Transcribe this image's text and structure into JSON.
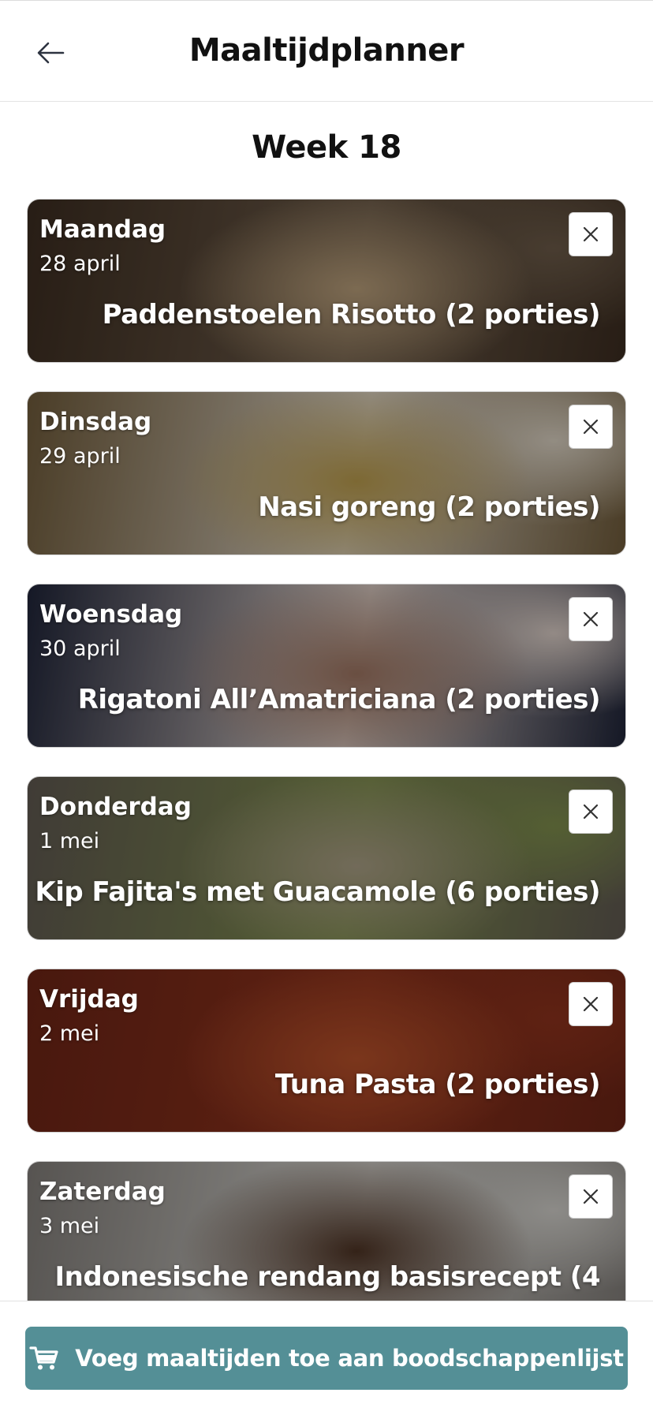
{
  "header": {
    "title": "Maaltijdplanner",
    "back_icon": "arrow-left-icon"
  },
  "week": {
    "label": "Week 18"
  },
  "days": [
    {
      "day": "Maandag",
      "date": "28 april",
      "meal": "Paddenstoelen Risotto (2 porties)",
      "remove_icon": "close-icon",
      "colors": [
        "#3b2c20",
        "#b79d79",
        "#6b5a48"
      ]
    },
    {
      "day": "Dinsdag",
      "date": "29 april",
      "meal": "Nasi goreng (2 porties)",
      "remove_icon": "close-icon",
      "colors": [
        "#6e5a3a",
        "#b89a4c",
        "#d8cfc0"
      ]
    },
    {
      "day": "Woensdag",
      "date": "30 april",
      "meal": "Rigatoni All’Amatriciana (2 porties)",
      "remove_icon": "close-icon",
      "colors": [
        "#1f2438",
        "#9c7461",
        "#d9ccc5"
      ]
    },
    {
      "day": "Donderdag",
      "date": "1 mei",
      "meal": "Kip Fajita's met Guacamole (6 porties)",
      "remove_icon": "close-icon",
      "colors": [
        "#5f5850",
        "#a89d84",
        "#7d8c4c"
      ]
    },
    {
      "day": "Vrijdag",
      "date": "2 mei",
      "meal": "Tuna Pasta (2 porties)",
      "remove_icon": "close-icon",
      "colors": [
        "#6b2416",
        "#b5502a",
        "#8c321c"
      ]
    },
    {
      "day": "Zaterdag",
      "date": "3 mei",
      "meal": "Indonesische rendang basisrecept (4",
      "remove_icon": "close-icon",
      "colors": [
        "#807c78",
        "#4d3324",
        "#cfcdc8"
      ]
    }
  ],
  "footer": {
    "button_label": "Voeg maaltijden toe aan boodschappenlijst",
    "button_icon": "cart-icon",
    "button_color": "#548f96"
  }
}
